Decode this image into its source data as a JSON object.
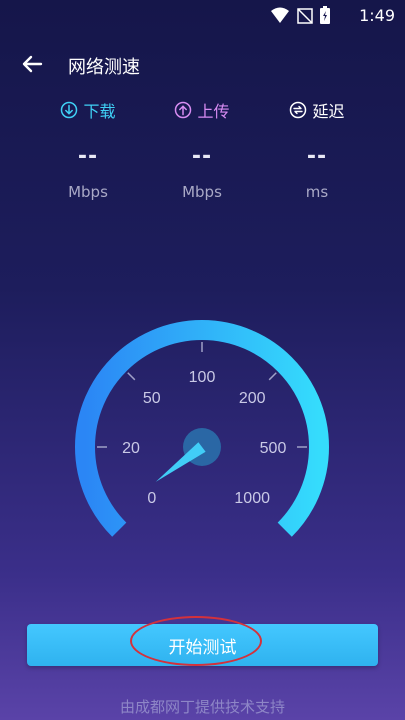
{
  "status": {
    "time": "1:49"
  },
  "header": {
    "title": "网络测速"
  },
  "metrics": [
    {
      "label": "下载",
      "value": "--",
      "unit": "Mbps",
      "color": "#3fd0f5",
      "icon": "download-icon"
    },
    {
      "label": "上传",
      "value": "--",
      "unit": "Mbps",
      "color": "#d78cf2",
      "icon": "upload-icon"
    },
    {
      "label": "延迟",
      "value": "--",
      "unit": "ms",
      "color": "#ffffff",
      "icon": "latency-icon"
    }
  ],
  "gauge": {
    "ticks": [
      "0",
      "20",
      "50",
      "100",
      "200",
      "500",
      "1000"
    ],
    "value": 0,
    "color_start": "#2b86f5",
    "color_end": "#35dcfc"
  },
  "start_button": {
    "label": "开始测试"
  },
  "footer": {
    "text": "由成都网丁提供技术支持"
  },
  "colors": {
    "highlight_ring": "#d4313b"
  }
}
